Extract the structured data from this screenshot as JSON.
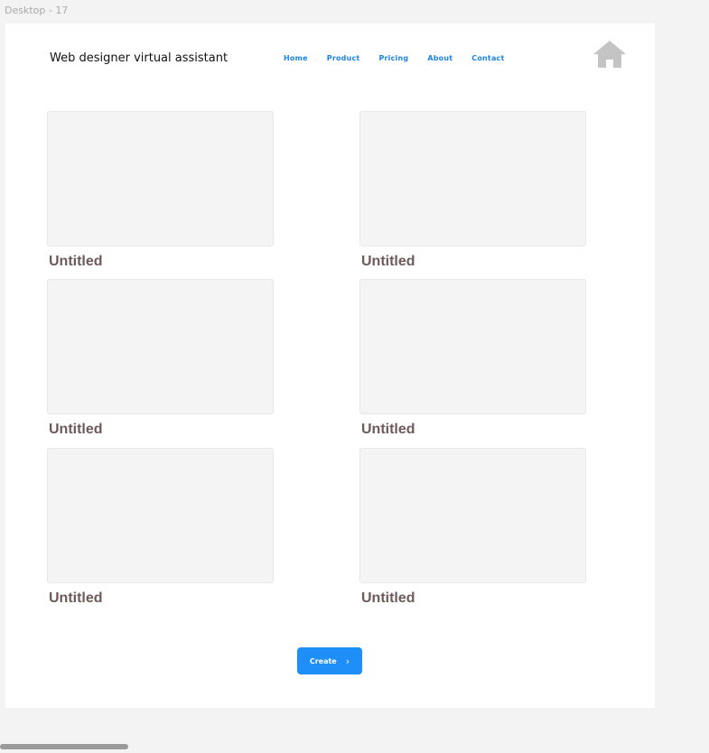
{
  "canvas": {
    "frame_label": "Desktop - 17"
  },
  "header": {
    "brand": "Web designer virtual assistant",
    "nav": [
      "Home",
      "Product",
      "Pricing",
      "About",
      "Contact"
    ],
    "home_icon": "home-icon"
  },
  "cards": [
    {
      "title": "Untitled"
    },
    {
      "title": "Untitled"
    },
    {
      "title": "Untitled"
    },
    {
      "title": "Untitled"
    },
    {
      "title": "Untitled"
    },
    {
      "title": "Untitled"
    }
  ],
  "create_button": {
    "label": "Create",
    "icon": "chevron-right-icon",
    "color": "#1e8ef8"
  },
  "colors": {
    "nav_link": "#1b84e6",
    "card_title": "#6e5a5a",
    "home_icon": "#c4c4c4"
  }
}
